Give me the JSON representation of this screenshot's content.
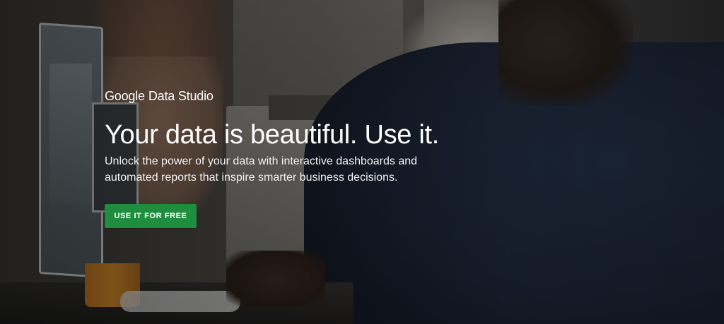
{
  "hero": {
    "brand": {
      "google": "Google",
      "product": "Data Studio"
    },
    "headline": "Your data is beautiful. Use it.",
    "subtext": "Unlock the power of your data with interactive dashboards and automated reports that inspire smarter business decisions.",
    "cta_label": "USE IT FOR FREE"
  },
  "colors": {
    "cta_background": "#1e8e3e",
    "text": "#ffffff"
  }
}
